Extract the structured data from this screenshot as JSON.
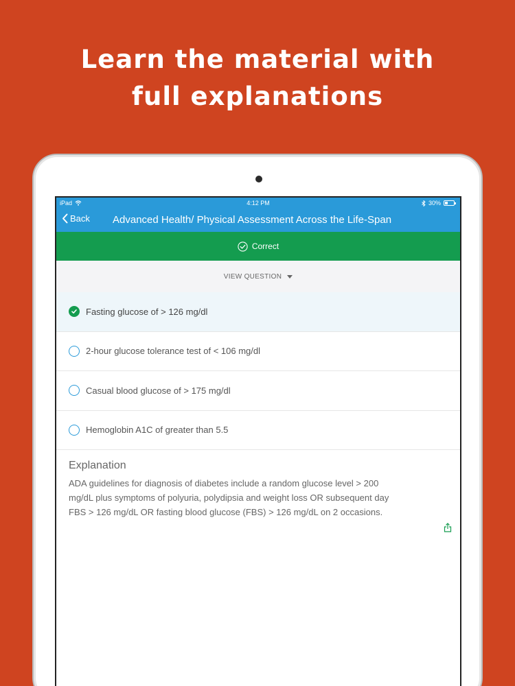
{
  "headline": {
    "line1": "Learn the material with",
    "line2": "full explanations"
  },
  "status_bar": {
    "device": "iPad",
    "time": "4:12 PM",
    "battery": "30%",
    "icons": [
      "wifi-icon",
      "bluetooth-icon",
      "battery-icon"
    ]
  },
  "navbar": {
    "back_label": "Back",
    "title": "Advanced Health/ Physical Assessment Across the Life-Span"
  },
  "result": {
    "label": "Correct"
  },
  "view_question": {
    "label": "VIEW QUESTION"
  },
  "answers": [
    {
      "text": "Fasting glucose of > 126 mg/dl",
      "selected": true
    },
    {
      "text": "2-hour glucose tolerance test of < 106 mg/dl",
      "selected": false
    },
    {
      "text": "Casual blood glucose of > 175 mg/dl",
      "selected": false
    },
    {
      "text": "Hemoglobin A1C of greater than 5.5",
      "selected": false
    }
  ],
  "explanation": {
    "title": "Explanation",
    "body_lines": [
      "ADA guidelines for diagnosis of diabetes include a random glucose level > 200",
      "mg/dL plus symptoms of polyuria, polydipsia and weight loss OR subsequent day",
      "FBS > 126 mg/dL OR fasting blood glucose (FBS) > 126 mg/dL on 2 occasions."
    ]
  },
  "colors": {
    "background": "#cf4420",
    "navbar": "#2a9ad9",
    "correct": "#149c4f",
    "selected_row": "#eef6fa"
  }
}
